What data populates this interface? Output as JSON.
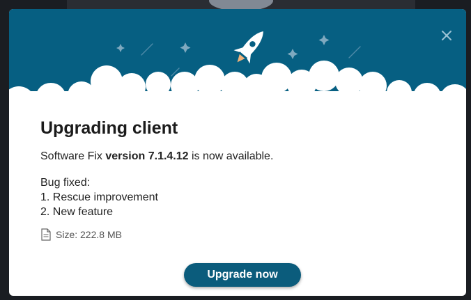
{
  "dialog": {
    "title": "Upgrading client",
    "version_prefix": "Software Fix ",
    "version_number": "version 7.1.4.12",
    "version_suffix": " is now available.",
    "notes": {
      "heading": "Bug fixed:",
      "items": [
        "1. Rescue improvement",
        "2. New feature"
      ]
    },
    "size_text": "Size: 222.8 MB",
    "upgrade_label": "Upgrade now"
  },
  "icons": {
    "close": "close-icon",
    "rocket": "rocket-icon",
    "file": "file-icon"
  },
  "colors": {
    "hero_background": "#065f82",
    "button_background": "#0b5c7c",
    "title_text": "#1b1b1b"
  }
}
